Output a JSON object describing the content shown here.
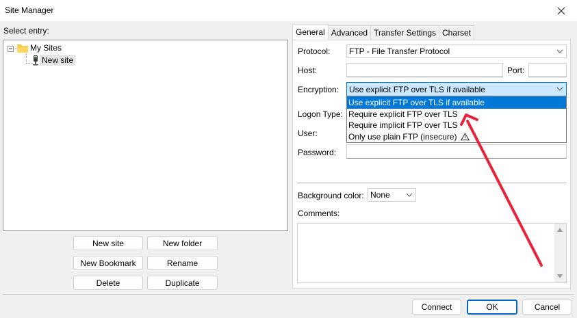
{
  "window": {
    "title": "Site Manager"
  },
  "select_entry_label": "Select entry:",
  "tree": {
    "root_label": "My Sites",
    "child_label": "New site"
  },
  "site_buttons": {
    "new_site": "New site",
    "new_folder": "New folder",
    "new_bookmark": "New Bookmark",
    "rename": "Rename",
    "delete": "Delete",
    "duplicate": "Duplicate"
  },
  "tabs": [
    "General",
    "Advanced",
    "Transfer Settings",
    "Charset"
  ],
  "general": {
    "protocol_label": "Protocol:",
    "protocol_value": "FTP - File Transfer Protocol",
    "host_label": "Host:",
    "host_value": "",
    "port_label": "Port:",
    "port_value": "",
    "encryption_label": "Encryption:",
    "encryption_value": "Use explicit FTP over TLS if available",
    "encryption_options": [
      "Use explicit FTP over TLS if available",
      "Require explicit FTP over TLS",
      "Require implicit FTP over TLS",
      "Only use plain FTP (insecure)"
    ],
    "logon_type_label": "Logon Type:",
    "user_label": "User:",
    "password_label": "Password:",
    "password_value": "",
    "background_color_label": "Background color:",
    "background_color_value": "None",
    "comments_label": "Comments:",
    "comments_value": ""
  },
  "dialog_buttons": {
    "connect": "Connect",
    "ok": "OK",
    "cancel": "Cancel"
  },
  "colors": {
    "selection_blue": "#0078d7",
    "focus_bg": "#cce8ff",
    "annotation_arrow": "#e8223a",
    "folder_yellow": "#f4c542"
  }
}
